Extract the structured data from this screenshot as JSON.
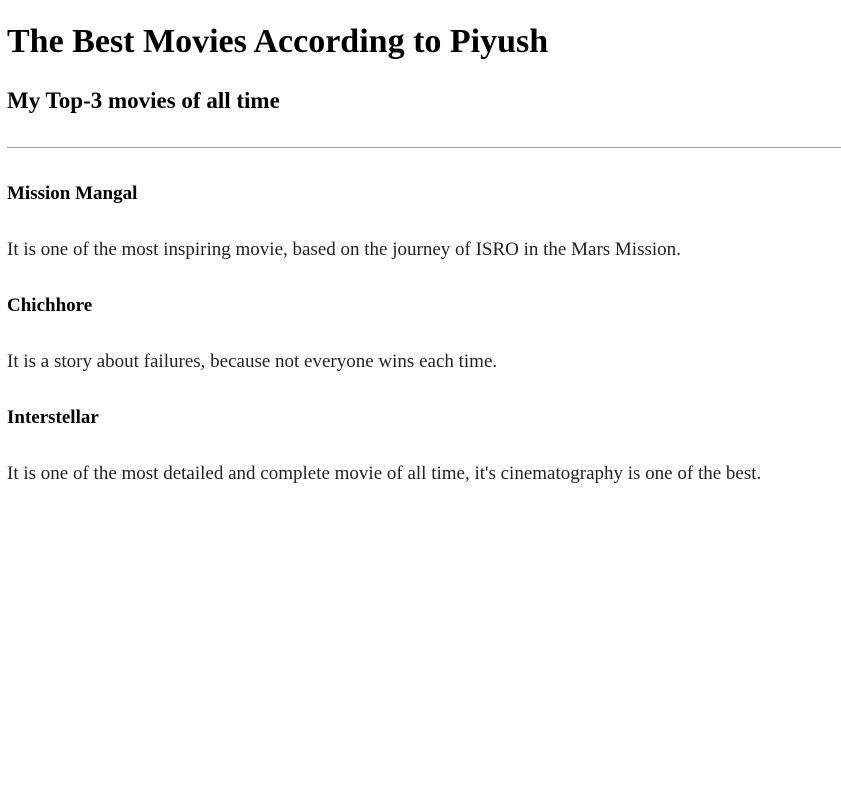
{
  "page": {
    "title": "The Best Movies According to Piyush",
    "subtitle": "My Top-3 movies of all time"
  },
  "movies": [
    {
      "name": "Mission Mangal",
      "description": "It is one of the most inspiring movie, based on the journey of ISRO in the Mars Mission."
    },
    {
      "name": "Chichhore",
      "description": "It is a story about failures, because not everyone wins each time."
    },
    {
      "name": "Interstellar",
      "description": "It is one of the most detailed and complete movie of all time, it's cinematography is one of the best."
    }
  ]
}
